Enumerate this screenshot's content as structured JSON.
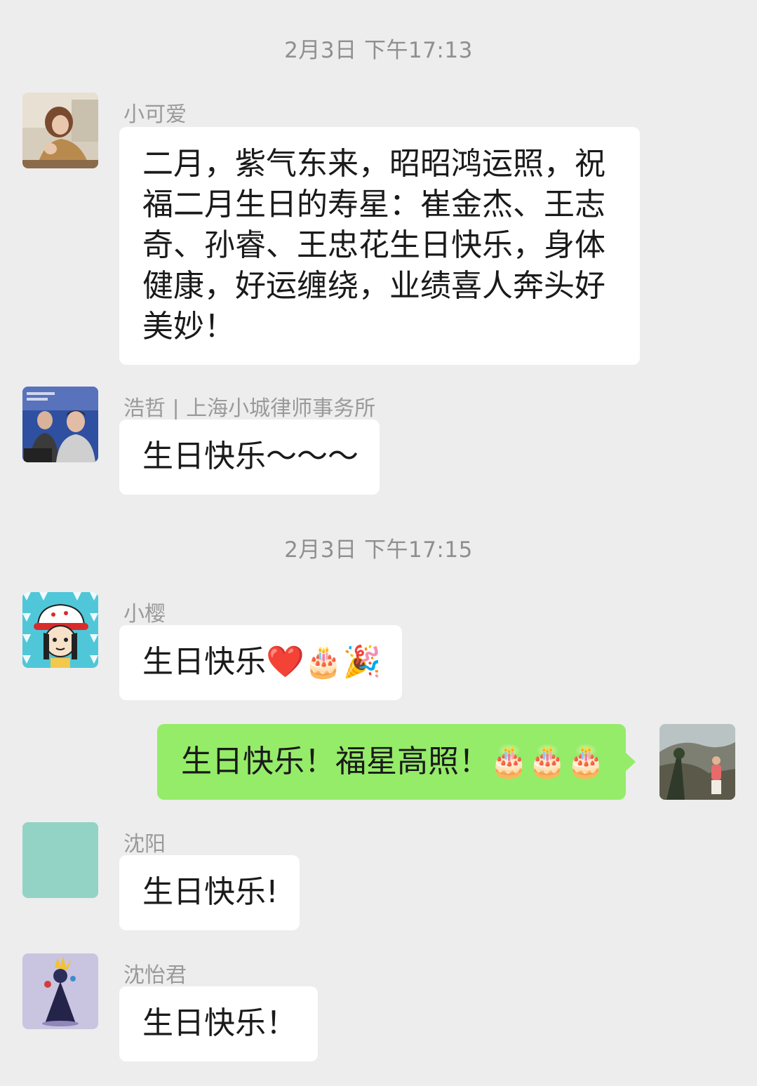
{
  "messages": {
    "timestamp_1": "2月3日 下午17:13",
    "msg1": {
      "sender": "小可爱",
      "text": "二月，紫气东来，昭昭鸿运照，祝福二月生日的寿星：崔金杰、王志奇、孙睿、王忠花生日快乐，身体健康，好运缠绕，业绩喜人奔头好美妙！"
    },
    "msg2": {
      "sender": "浩哲 | 上海小城律师事务所",
      "text": "生日快乐～～～"
    },
    "timestamp_2": "2月3日 下午17:15",
    "msg3": {
      "sender": "小樱",
      "text": "生日快乐",
      "emojis": "❤️🎂🎉"
    },
    "msg4_self": {
      "text": "生日快乐！福星高照！",
      "emojis": "🎂🎂🎂"
    },
    "msg5": {
      "sender": "沈阳",
      "text": "生日快乐!"
    },
    "msg6": {
      "sender": "沈怡君",
      "text": "生日快乐！"
    }
  },
  "colors": {
    "background": "#ededed",
    "bubble_other": "#ffffff",
    "bubble_self": "#95ec69",
    "sender_text": "#9a9a9a",
    "timestamp_text": "#8f8f8f",
    "avatar_teal": "#92d3c6"
  },
  "avatars": {
    "msg1": "photo-avatar-woman",
    "msg2": "photo-avatar-man",
    "msg3": "cartoon-girl-avatar",
    "msg4_self": "landscape-photo-avatar",
    "msg5": "solid-teal-avatar",
    "msg6": "cartoon-figure-avatar"
  }
}
